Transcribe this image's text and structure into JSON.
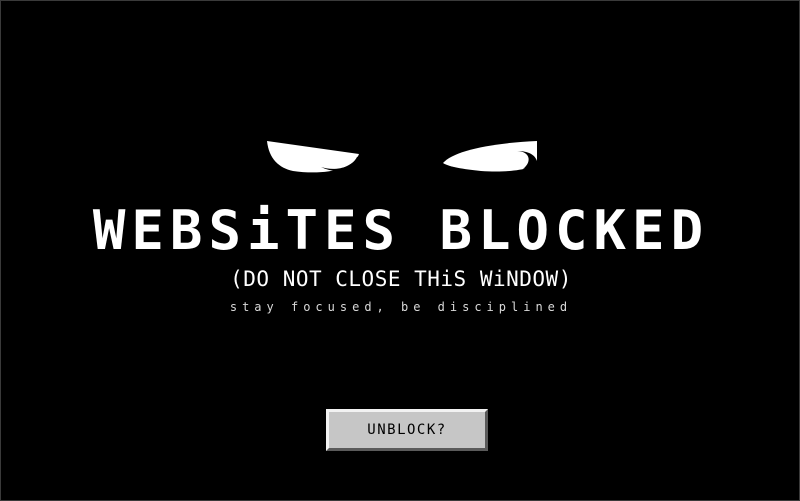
{
  "screen": {
    "title": "WEBSiTES BLOCKED",
    "subtitle": "(DO NOT CLOSE THiS WiNDOW)",
    "tagline": "stay focused, be disciplined",
    "unblock_label": "UNBLOCK?",
    "background_color": "#000000",
    "text_color": "#ffffff",
    "button_color": "#c6c6c6"
  },
  "icons": {
    "eyes": "angry-eyes-icon"
  }
}
